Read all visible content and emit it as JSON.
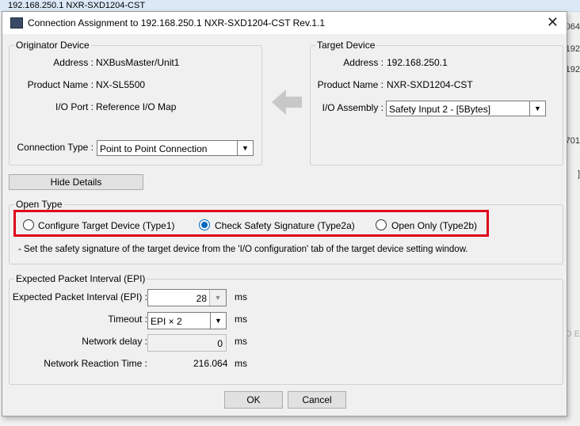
{
  "background": {
    "top_text": "192.168.250.1 NXR-SXD1204-CST",
    "right_fragments": [
      "064",
      "192",
      "192",
      "701",
      "]",
      "D E"
    ]
  },
  "dialog": {
    "title": "Connection Assignment to 192.168.250.1 NXR-SXD1204-CST Rev.1.1",
    "close_glyph": "✕"
  },
  "originator": {
    "legend": "Originator Device",
    "address_label": "Address :",
    "address_value": "NXBusMaster/Unit1",
    "product_label": "Product Name :",
    "product_value": "NX-SL5500",
    "io_port_label": "I/O Port :",
    "io_port_value": "Reference I/O Map",
    "connection_type_label": "Connection Type :",
    "connection_type_value": "Point to Point Connection"
  },
  "target": {
    "legend": "Target Device",
    "address_label": "Address :",
    "address_value": "192.168.250.1",
    "product_label": "Product Name :",
    "product_value": "NXR-SXD1204-CST",
    "io_assembly_label": "I/O Assembly :",
    "io_assembly_value": "Safety Input 2 - [5Bytes]"
  },
  "hide_details_label": "Hide Details",
  "open_type": {
    "legend": "Open Type",
    "options": [
      {
        "label": "Configure Target Device (Type1)",
        "selected": false
      },
      {
        "label": "Check Safety Signature (Type2a)",
        "selected": true
      },
      {
        "label": "Open Only (Type2b)",
        "selected": false
      }
    ],
    "note": "- Set the safety signature of the target device from the 'I/O configuration' tab of the target device setting window.",
    "highlight_color": "#e0001a"
  },
  "epi": {
    "legend": "Expected Packet Interval (EPI)",
    "epi_label": "Expected Packet Interval (EPI) :",
    "epi_value": "28",
    "epi_unit": "ms",
    "timeout_label": "Timeout :",
    "timeout_value": "EPI × 2",
    "timeout_unit": "ms",
    "network_delay_label": "Network delay :",
    "network_delay_value": "0",
    "network_delay_unit": "ms",
    "reaction_label": "Network Reaction Time :",
    "reaction_value": "216.064",
    "reaction_unit": "ms"
  },
  "buttons": {
    "ok": "OK",
    "cancel": "Cancel"
  },
  "colors": {
    "accent": "#0067c0",
    "arrow": "#c8c8c8"
  }
}
